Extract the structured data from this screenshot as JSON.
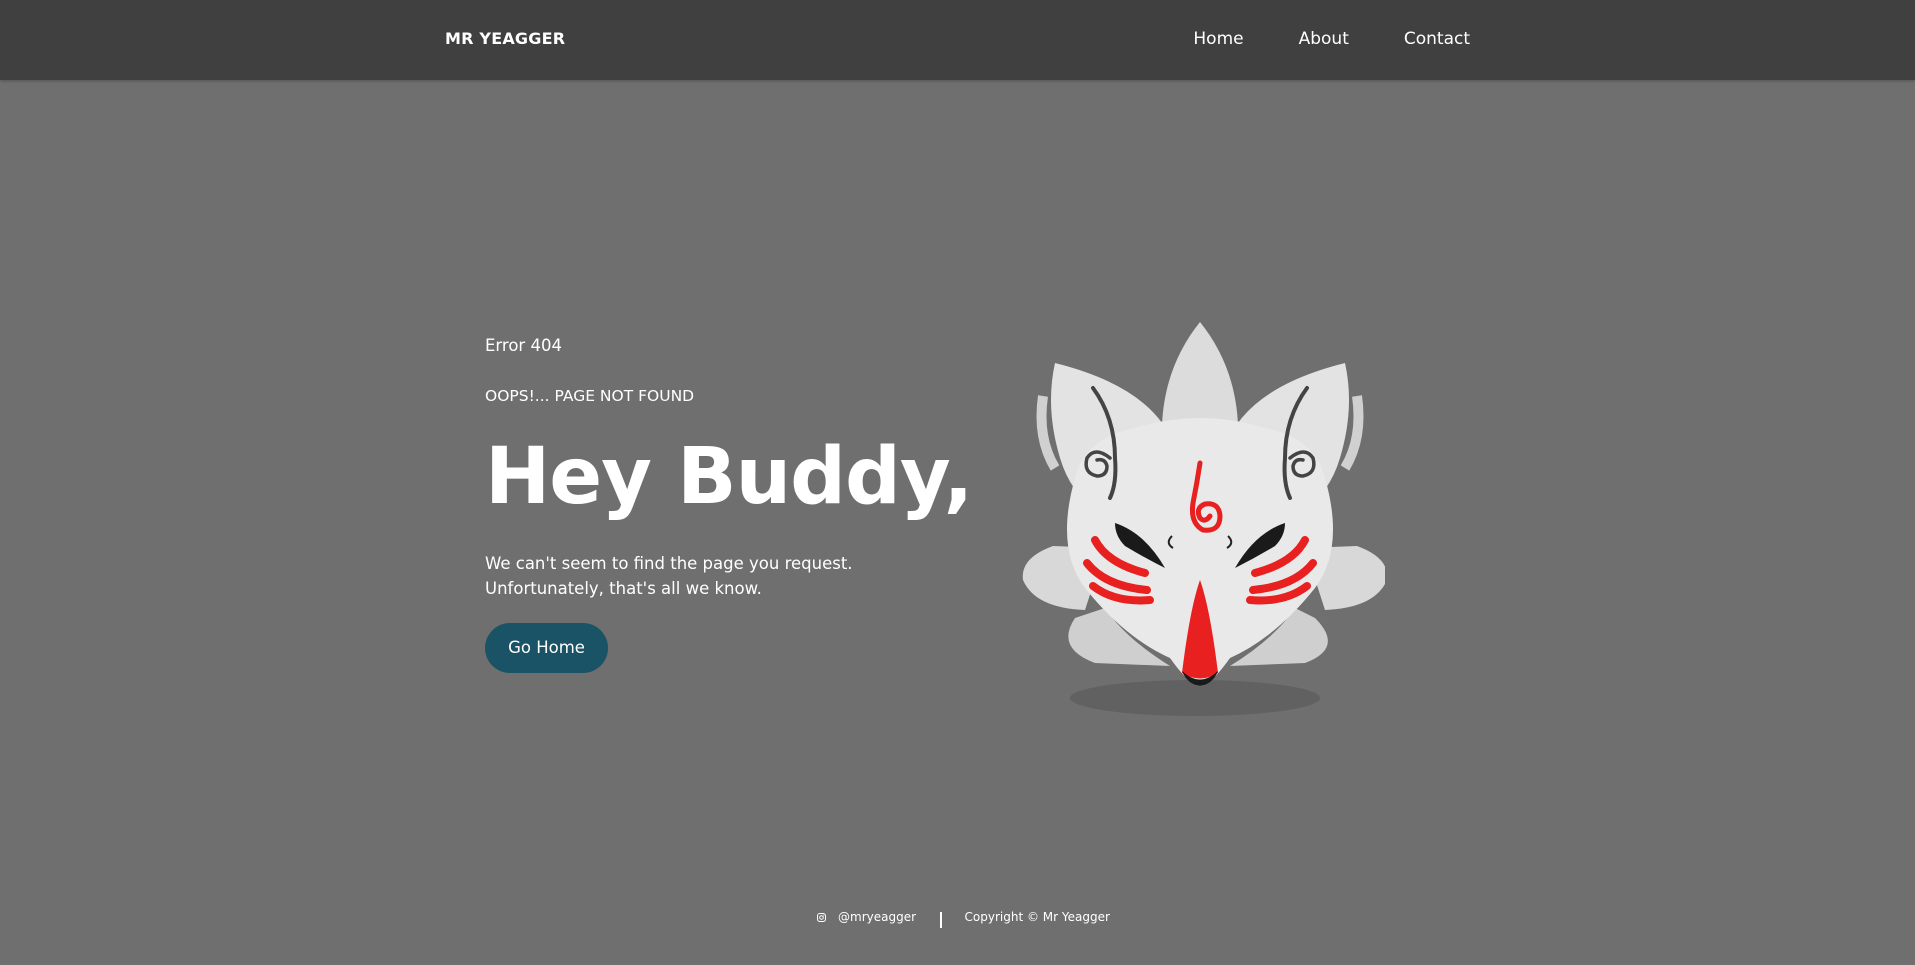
{
  "navbar": {
    "brand": "MR YEAGGER",
    "links": [
      "Home",
      "About",
      "Contact"
    ]
  },
  "main": {
    "error_code": "Error 404",
    "subtitle": "OOPS!... PAGE NOT FOUND",
    "headline": "Hey Buddy,",
    "message_line1": "We can't seem to find the page you request.",
    "message_line2": "Unfortunately, that's all we know.",
    "button_label": "Go Home",
    "illustration": "kitsune-fox-mask-illustration"
  },
  "footer": {
    "instagram_icon": "instagram-icon",
    "instagram_handle": "@mryeagger",
    "copyright": "Copyright © Mr Yeagger"
  },
  "colors": {
    "navbar_bg": "#404040",
    "page_bg": "#6f6f6f",
    "button_bg": "#1a5266",
    "mask_red": "#e8201f",
    "mask_white": "#e6e6e6"
  }
}
